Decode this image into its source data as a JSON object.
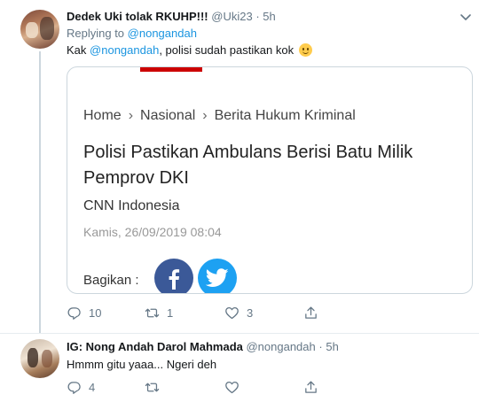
{
  "tweets": [
    {
      "name": "Dedek Uki tolak RKUHP!!!",
      "handle": "@Uki23",
      "dot": "·",
      "time": "5h",
      "replying_prefix": "Replying to",
      "replying_to": "@nongandah",
      "text_prefix": "Kak",
      "mention": "@nongandah",
      "text_suffix": ", polisi sudah pastikan kok",
      "replies": "10",
      "retweets": "1",
      "likes": "3"
    },
    {
      "name": "IG: Nong Andah Darol Mahmada",
      "handle": "@nongandah",
      "dot": "·",
      "time": "5h",
      "text": "Hmmm gitu yaaa... Ngeri deh",
      "replies": "4"
    }
  ],
  "card": {
    "breadcrumbs": [
      "Home",
      "Nasional",
      "Berita Hukum Kriminal"
    ],
    "separator": "›",
    "title": "Polisi Pastikan Ambulans Berisi Batu Milik Pemprov DKI",
    "source": "CNN Indonesia",
    "date": "Kamis, 26/09/2019 08:04",
    "share_label": "Bagikan :"
  },
  "icons": {
    "reply": "reply-icon",
    "retweet": "retweet-icon",
    "like": "heart-icon",
    "share": "share-icon",
    "caret": "chevron-down-icon",
    "facebook": "facebook-icon",
    "twitter": "twitter-icon"
  },
  "colors": {
    "link": "#1b95e0",
    "muted": "#657786",
    "facebook": "#3b5998",
    "twitter": "#1da1f2",
    "cnn_red": "#cc0000"
  }
}
